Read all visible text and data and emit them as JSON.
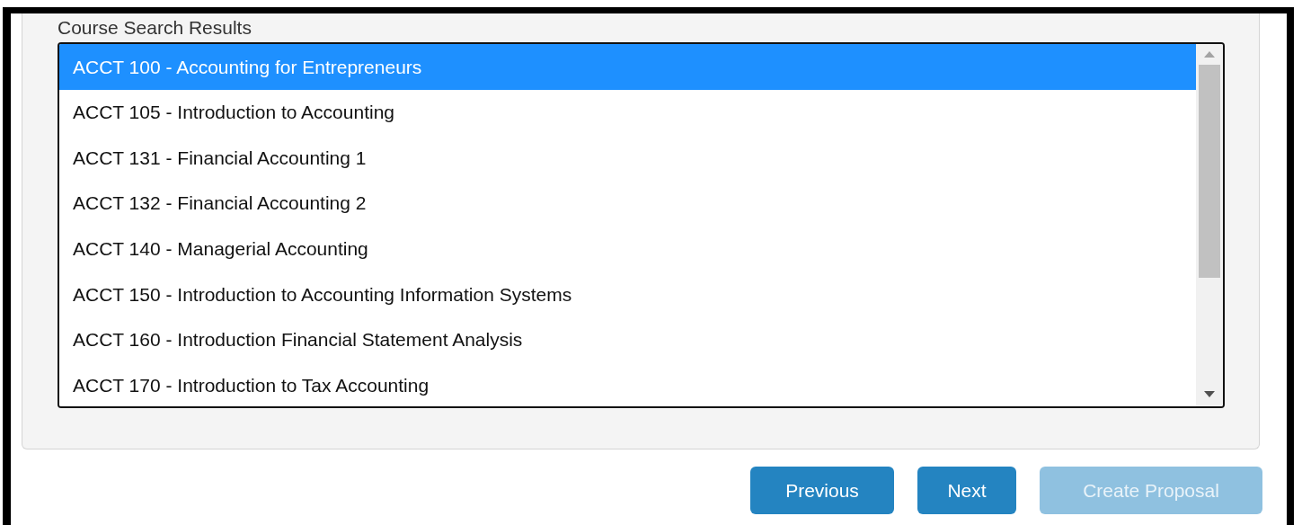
{
  "section_label": "Course Search Results",
  "courses": [
    {
      "label": "ACCT 100 - Accounting for Entrepreneurs",
      "selected": true
    },
    {
      "label": "ACCT 105 - Introduction to Accounting",
      "selected": false
    },
    {
      "label": "ACCT 131 - Financial Accounting 1",
      "selected": false
    },
    {
      "label": "ACCT 132 - Financial Accounting 2",
      "selected": false
    },
    {
      "label": "ACCT 140 - Managerial Accounting",
      "selected": false
    },
    {
      "label": "ACCT 150 - Introduction to Accounting Information Systems",
      "selected": false
    },
    {
      "label": "ACCT 160 - Introduction Financial Statement Analysis",
      "selected": false
    },
    {
      "label": "ACCT 170 - Introduction to Tax Accounting",
      "selected": false
    }
  ],
  "buttons": [
    {
      "label": "Previous",
      "disabled": false
    },
    {
      "label": "Next",
      "disabled": false
    },
    {
      "label": "Create Proposal",
      "disabled": true
    }
  ]
}
